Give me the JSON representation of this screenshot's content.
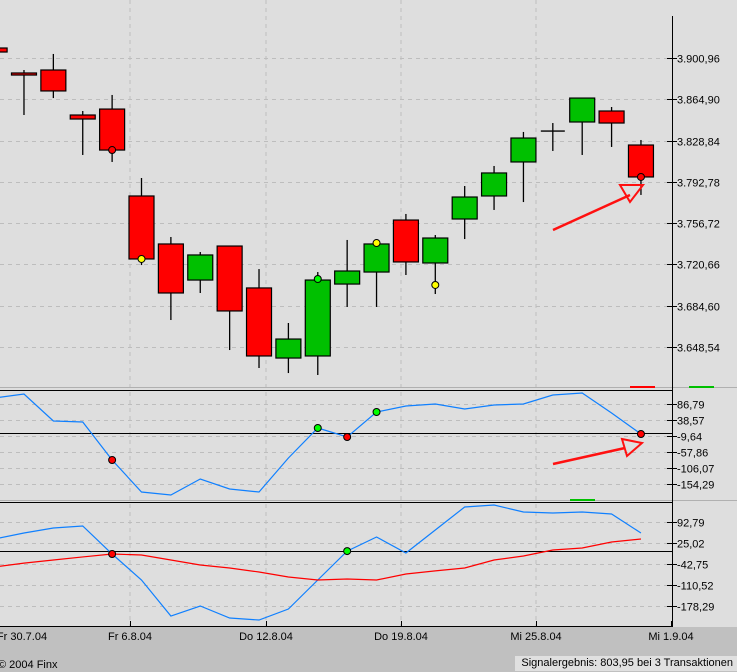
{
  "chart_data": {
    "type": "candlestick",
    "price_panel": {
      "y_ticks": [
        3900.96,
        3864.9,
        3828.84,
        3792.78,
        3756.72,
        3720.66,
        3684.6,
        3648.54
      ],
      "y_tick_labels": [
        "3.900,96",
        "3.864,90",
        "3.828,84",
        "3.792,78",
        "3.756,72",
        "3.720,66",
        "3.684,60",
        "3.648,54"
      ],
      "candles": [
        [
          3909.6,
          3909.6,
          3906.1,
          3906.1
        ],
        [
          3887.8,
          3890.4,
          3851.1,
          3886.0
        ],
        [
          3890.4,
          3904.4,
          3865.9,
          3872.1
        ],
        [
          3851.1,
          3854.6,
          3816.2,
          3847.6
        ],
        [
          3856.3,
          3868.6,
          3810.1,
          3820.5
        ],
        [
          3780.4,
          3796.1,
          3720.1,
          3725.4
        ],
        [
          3738.5,
          3744.6,
          3672.1,
          3695.7
        ],
        [
          3707.0,
          3731.5,
          3695.7,
          3728.9
        ],
        [
          3736.7,
          3736.7,
          3645.9,
          3680.0
        ],
        [
          3700.1,
          3716.6,
          3630.2,
          3640.7
        ],
        [
          3638.9,
          3669.5,
          3625.8,
          3655.5
        ],
        [
          3640.7,
          3714.0,
          3624.1,
          3707.0
        ],
        [
          3703.5,
          3742.0,
          3683.5,
          3714.9
        ],
        [
          3714.0,
          3742.0,
          3683.5,
          3738.5
        ],
        [
          3759.4,
          3764.7,
          3711.4,
          3722.8
        ],
        [
          3721.9,
          3746.3,
          3694.8,
          3743.7
        ],
        [
          3760.3,
          3789.1,
          3742.8,
          3779.5
        ],
        [
          3780.4,
          3806.6,
          3768.2,
          3800.5
        ],
        [
          3810.1,
          3836.3,
          3775.1,
          3831.0
        ],
        [
          3837.1,
          3844.1,
          3819.7,
          3837.1
        ],
        [
          3845.0,
          3865.9,
          3816.2,
          3865.9
        ],
        [
          3854.6,
          3858.1,
          3823.2,
          3844.1
        ],
        [
          3824.9,
          3829.3,
          3781.3,
          3797.0
        ]
      ],
      "signals": [
        {
          "i": 4,
          "value": 3820.5,
          "color": "#ff0000"
        },
        {
          "i": 5,
          "value": 3725.4,
          "color": "#ffff00"
        },
        {
          "i": 11,
          "value": 3707.9,
          "color": "#00ff00"
        },
        {
          "i": 13,
          "value": 3739.3,
          "color": "#ffff00"
        },
        {
          "i": 15,
          "value": 3702.7,
          "color": "#ffff00"
        },
        {
          "i": 22,
          "value": 3797.0,
          "color": "#ff0000"
        }
      ]
    },
    "indicator1": {
      "y_ticks": [
        86.79,
        38.57,
        -9.64,
        -57.86,
        -106.07,
        -154.29
      ],
      "y_tick_labels": [
        "86,79",
        "38,57",
        "-9,64",
        "-57,86",
        "-106,07",
        "-154,29"
      ],
      "zero_line": 0,
      "series": [
        {
          "name": "oscillator",
          "color": "#1080ff",
          "values": [
            104.9,
            116.9,
            35.6,
            32.6,
            -81.9,
            -178.4,
            -187.4,
            -139.2,
            -169.3,
            -178.4,
            -75.9,
            14.5,
            -12.6,
            62.7,
            80.8,
            86.8,
            71.7,
            83.8,
            86.8,
            113.9,
            119.9,
            59.7,
            -3.6
          ]
        }
      ],
      "signals": [
        {
          "i": 4,
          "value": -81.9,
          "color": "#ff0000"
        },
        {
          "i": 11,
          "value": 14.5,
          "color": "#00ff00"
        },
        {
          "i": 12,
          "value": -12.6,
          "color": "#ff0000"
        },
        {
          "i": 13,
          "value": 62.7,
          "color": "#00ff00"
        },
        {
          "i": 22,
          "value": -3.6,
          "color": "#ff0000"
        }
      ]
    },
    "indicator2": {
      "y_ticks": [
        92.79,
        25.02,
        -42.75,
        -110.52,
        -178.29
      ],
      "y_tick_labels": [
        "92,79",
        "25,02",
        "-42,75",
        "-110,52",
        "-178,29"
      ],
      "zero_line": 0,
      "series": [
        {
          "name": "line",
          "color": "#1080ff",
          "values": [
            37.9,
            57.3,
            73.4,
            79.9,
            -10.5,
            -94.4,
            -210.6,
            -178.3,
            -217.0,
            -223.5,
            -188.0,
            -94.4,
            -1.0,
            44.4,
            -7.2,
            67.0,
            141.2,
            147.6,
            125.1,
            121.8,
            125.1,
            118.6,
            57.3
          ]
        },
        {
          "name": "signal",
          "color": "#ff0000",
          "values": [
            -52.4,
            -40.0,
            -29.8,
            -20.0,
            -10.5,
            -13.7,
            -29.8,
            -46.0,
            -55.7,
            -68.6,
            -84.7,
            -94.4,
            -91.2,
            -94.4,
            -75.0,
            -65.0,
            -55.7,
            -29.8,
            -17.0,
            2.4,
            8.9,
            28.2,
            37.9
          ]
        }
      ],
      "signals": [
        {
          "i": 4,
          "value": -10.5,
          "color": "#ff0000"
        },
        {
          "i": 12,
          "value": -1.0,
          "color": "#00ff00"
        }
      ]
    },
    "x_tick_labels": [
      "Fr 30.7.04",
      "Fr 6.8.04",
      "Do 12.8.04",
      "Do 19.8.04",
      "Mi 25.8.04",
      "Mi 1.9.04"
    ],
    "colors": {
      "up": "#00c000",
      "down": "#ff0000",
      "background": "#dedede"
    }
  },
  "footer": {
    "copyright": "© 2004 Finx",
    "signal_result": "Signalergebnis: 803,95 bei 3 Transaktionen"
  }
}
